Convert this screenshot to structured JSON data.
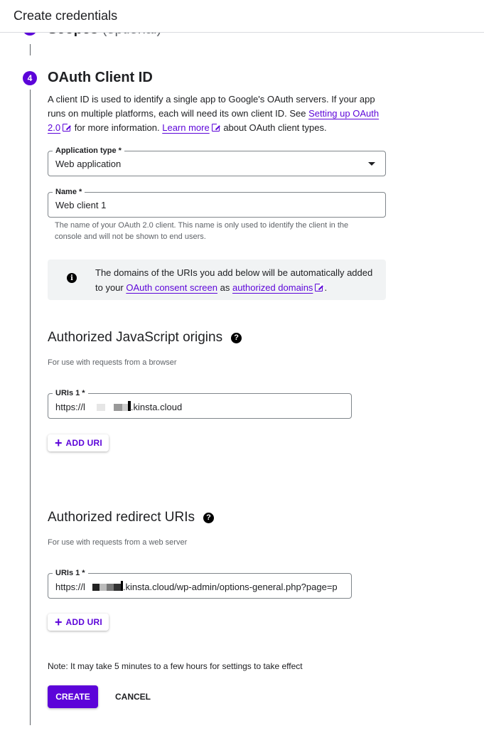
{
  "header": {
    "title": "Create credentials"
  },
  "previous_step": {
    "label": "Scopes",
    "optional": "(optional)"
  },
  "step": {
    "number": "4",
    "title": "OAuth Client ID",
    "description": {
      "part1": "A client ID is used to identify a single app to Google's OAuth servers. If your app runs on multiple platforms, each will need its own client ID. See ",
      "link1": "Setting up OAuth 2.0",
      "part2": " for more information. ",
      "link2": "Learn more",
      "part3": " about OAuth client types."
    }
  },
  "application_type": {
    "label": "Application type *",
    "value": "Web application"
  },
  "name_field": {
    "label": "Name *",
    "value": "Web client 1",
    "hint": "The name of your OAuth 2.0 client. This name is only used to identify the client in the console and will not be shown to end users."
  },
  "notice": {
    "part1": "The domains of the URIs you add below will be automatically added to your ",
    "link1": "OAuth consent screen",
    "part2": " as ",
    "link2": "authorized domains",
    "part3": "."
  },
  "js_origins": {
    "title": "Authorized JavaScript origins",
    "subtitle": "For use with requests from a browser",
    "uri_label": "URIs 1 *",
    "uri_prefix": "https://l",
    "uri_suffix": ".kinsta.cloud",
    "add_label": "ADD URI"
  },
  "redirect_uris": {
    "title": "Authorized redirect URIs",
    "subtitle": "For use with requests from a web server",
    "uri_label": "URIs 1 *",
    "uri_prefix": "https://l",
    "uri_suffix": ".kinsta.cloud/wp-admin/options-general.php?page=p",
    "add_label": "ADD URI"
  },
  "note": "Note: It may take 5 minutes to a few hours for settings to take effect",
  "actions": {
    "create": "CREATE",
    "cancel": "CANCEL"
  },
  "colors": {
    "accent": "#5c04d9",
    "text": "#202124",
    "muted": "#5f6368",
    "notice_bg": "#f1f3f4"
  }
}
